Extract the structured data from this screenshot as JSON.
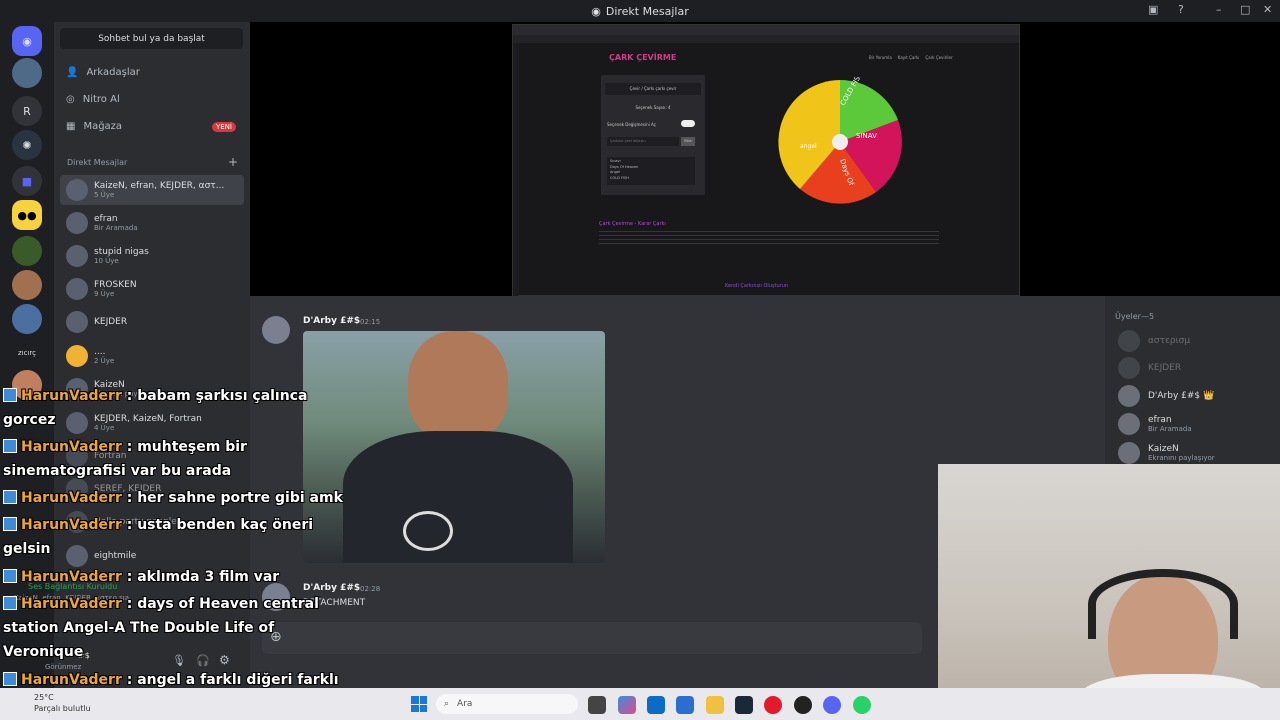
{
  "titlebar": {
    "title": "Direkt Mesajlar"
  },
  "servers": {
    "letter_r": "R",
    "zicirc": "zıcırç"
  },
  "dm_panel": {
    "search_label": "Sohbet bul ya da başlat",
    "nav": [
      {
        "label": "Arkadaşlar",
        "icon": "friends-icon"
      },
      {
        "label": "Nitro Al",
        "icon": "nitro-icon"
      },
      {
        "label": "Mağaza",
        "icon": "shop-icon",
        "badge": "YENİ"
      }
    ],
    "section_title": "Direkt Mesajlar",
    "add_label": "+",
    "items": [
      {
        "name": "KaizeN, efran, KEJDER, αστ...",
        "sub": "5 Üye"
      },
      {
        "name": "efran",
        "sub": "Bir Aramada"
      },
      {
        "name": "stupid nigas",
        "sub": "10 Üye"
      },
      {
        "name": "FROSKEN",
        "sub": "9 Üye"
      },
      {
        "name": "KEJDER",
        "sub": ""
      },
      {
        "name": "....",
        "sub": "2 Üye"
      },
      {
        "name": "KaizeN",
        "sub": "Ekranını paylaşıyor"
      },
      {
        "name": "KEJDER, KaizeN, Fortran",
        "sub": "4 Üye"
      },
      {
        "name": "Fortran",
        "sub": ""
      },
      {
        "name": "SEREF, KEJDER",
        "sub": ""
      },
      {
        "name": "Hello party people",
        "sub": ""
      },
      {
        "name": "eightmile",
        "sub": ""
      }
    ],
    "voice_status": "Ses Bağlantısı Kuruldu",
    "voice_channel": "KaizeN, efran, KEJDER, αστερ.sıa",
    "user_status": "Görünmez",
    "user_tag": "#$"
  },
  "screen_share": {
    "site_title": "ÇARK ÇEVİRME",
    "nav_links": [
      "Bir Yorumla",
      "Kayıt Çarkı",
      "Çark Çeviriler"
    ],
    "panel_title": "Çevir / Çarkı çarkı çevir",
    "panel_sub": "Seçenek Sayısı: 4",
    "toggle_label": "Seçenek Değişmesini Aç",
    "input_placeholder": "Çarkına yeni ekleyin",
    "add_button": "Ekle",
    "options": [
      "Sınavı",
      "Days Of Heaven",
      "Angel",
      "COLD FISH"
    ],
    "wheel_labels": [
      "COLD FISH",
      "SINAV",
      "Days Of",
      "angel"
    ],
    "wheel_colors": [
      "#5cc93b",
      "#d4145a",
      "#e8401f",
      "#f0c419"
    ],
    "section_heading": "Çark Çevirme - Karar Çarkı",
    "section_heading2": "Kendi Çarkınızı Oluşturun"
  },
  "chat": {
    "messages": [
      {
        "author": "D'Arby £#$",
        "time": "02:15",
        "text": ""
      },
      {
        "author": "D'Arby £#$",
        "time": "02:28",
        "text": "DETACHMENT"
      }
    ]
  },
  "members": {
    "header": "Üyeler—5",
    "list": [
      {
        "name": "αστερισμ",
        "sub": "",
        "dim": true
      },
      {
        "name": "KEJDER",
        "sub": "",
        "dim": true
      },
      {
        "name": "D'Arby £#$ 👑",
        "sub": "",
        "dim": false
      },
      {
        "name": "efran",
        "sub": "Bir Aramada",
        "dim": false
      },
      {
        "name": "KaizeN",
        "sub": "Ekranını paylaşıyor",
        "dim": false
      }
    ]
  },
  "overlay_chat": [
    {
      "user": "HarunVaderr",
      "text": " : babam şarkısı çalınca",
      "cont": "gorcez"
    },
    {
      "user": "HarunVaderr",
      "text": " : muhteşem bir",
      "cont": "sinematografisi var bu arada"
    },
    {
      "user": "HarunVaderr",
      "text": " : her sahne portre gibi amk",
      "cont": ""
    },
    {
      "user": "HarunVaderr",
      "text": " : usta benden kaç öneri",
      "cont": "gelsin"
    },
    {
      "user": "HarunVaderr",
      "text": " : aklımda 3 film var",
      "cont": ""
    },
    {
      "user": "HarunVaderr",
      "text": " : days of Heaven central",
      "cont": "station Angel-A The Double Life of",
      "cont2": "Veronique"
    },
    {
      "user": "HarunVaderr",
      "text": " : angel a farklı diğeri farklı",
      "cont": "awk"
    }
  ],
  "taskbar": {
    "search_placeholder": "Ara",
    "weather_temp": "25°C",
    "weather_desc": "Parçalı bulutlu"
  },
  "colors": {
    "accent": "#5865f2",
    "username_orange": "#f0a732",
    "badge_red": "#da373c"
  }
}
